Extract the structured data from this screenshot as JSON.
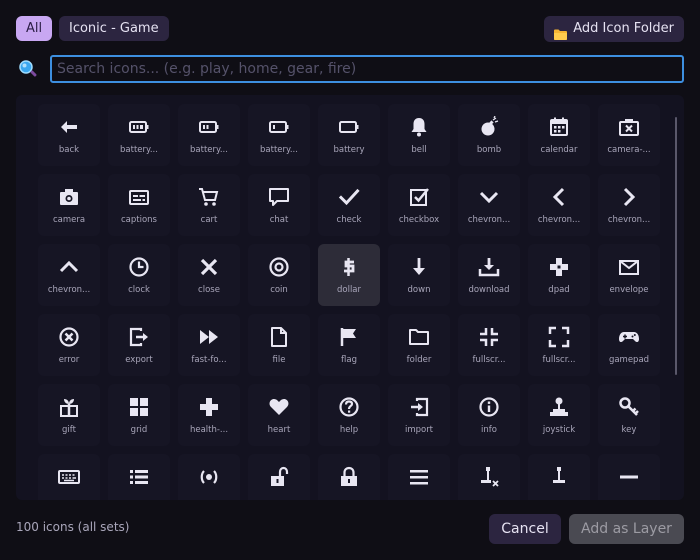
{
  "filters": {
    "all_label": "All",
    "set_label": "Iconic - Game"
  },
  "toolbar": {
    "add_folder_label": "Add Icon Folder"
  },
  "search": {
    "placeholder": "Search icons... (e.g. play, home, gear, fire)",
    "value": ""
  },
  "selected_icon": "dollar",
  "icons": [
    {
      "name": "back",
      "label": "back"
    },
    {
      "name": "battery-full",
      "label": "battery..."
    },
    {
      "name": "battery-half",
      "label": "battery..."
    },
    {
      "name": "battery-low",
      "label": "battery..."
    },
    {
      "name": "battery",
      "label": "battery"
    },
    {
      "name": "bell",
      "label": "bell"
    },
    {
      "name": "bomb",
      "label": "bomb"
    },
    {
      "name": "calendar",
      "label": "calendar"
    },
    {
      "name": "camera-x",
      "label": "camera-..."
    },
    {
      "name": "camera",
      "label": "camera"
    },
    {
      "name": "captions",
      "label": "captions"
    },
    {
      "name": "cart",
      "label": "cart"
    },
    {
      "name": "chat",
      "label": "chat"
    },
    {
      "name": "check",
      "label": "check"
    },
    {
      "name": "checkbox",
      "label": "checkbox"
    },
    {
      "name": "chevron-down",
      "label": "chevron..."
    },
    {
      "name": "chevron-left",
      "label": "chevron..."
    },
    {
      "name": "chevron-right",
      "label": "chevron..."
    },
    {
      "name": "chevron-up",
      "label": "chevron..."
    },
    {
      "name": "clock",
      "label": "clock"
    },
    {
      "name": "close",
      "label": "close"
    },
    {
      "name": "coin",
      "label": "coin"
    },
    {
      "name": "dollar",
      "label": "dollar"
    },
    {
      "name": "down",
      "label": "down"
    },
    {
      "name": "download",
      "label": "download"
    },
    {
      "name": "dpad",
      "label": "dpad"
    },
    {
      "name": "envelope",
      "label": "envelope"
    },
    {
      "name": "error",
      "label": "error"
    },
    {
      "name": "export",
      "label": "export"
    },
    {
      "name": "fast-forward",
      "label": "fast-fo..."
    },
    {
      "name": "file",
      "label": "file"
    },
    {
      "name": "flag",
      "label": "flag"
    },
    {
      "name": "folder",
      "label": "folder"
    },
    {
      "name": "fullscreen-exit",
      "label": "fullscr..."
    },
    {
      "name": "fullscreen",
      "label": "fullscr..."
    },
    {
      "name": "gamepad",
      "label": "gamepad"
    },
    {
      "name": "gift",
      "label": "gift"
    },
    {
      "name": "grid",
      "label": "grid"
    },
    {
      "name": "health",
      "label": "health-..."
    },
    {
      "name": "heart",
      "label": "heart"
    },
    {
      "name": "help",
      "label": "help"
    },
    {
      "name": "import",
      "label": "import"
    },
    {
      "name": "info",
      "label": "info"
    },
    {
      "name": "joystick",
      "label": "joystick"
    },
    {
      "name": "key",
      "label": "key"
    },
    {
      "name": "keyboard",
      "label": ""
    },
    {
      "name": "list",
      "label": ""
    },
    {
      "name": "live",
      "label": ""
    },
    {
      "name": "lock-open",
      "label": ""
    },
    {
      "name": "lock",
      "label": ""
    },
    {
      "name": "menu",
      "label": ""
    },
    {
      "name": "lever-x",
      "label": ""
    },
    {
      "name": "lever",
      "label": ""
    },
    {
      "name": "minus",
      "label": ""
    }
  ],
  "footer": {
    "count_label": "100 icons (all sets)",
    "cancel_label": "Cancel",
    "add_layer_label": "Add as Layer"
  },
  "colors": {
    "background": "#0f0e15",
    "panel": "#131220",
    "tile": "#161524",
    "tile_selected": "#2d2c38",
    "accent": "#c8a7f2",
    "chip": "#2c2540",
    "focus": "#3d8fe0",
    "icon": "#e8e6f2"
  }
}
